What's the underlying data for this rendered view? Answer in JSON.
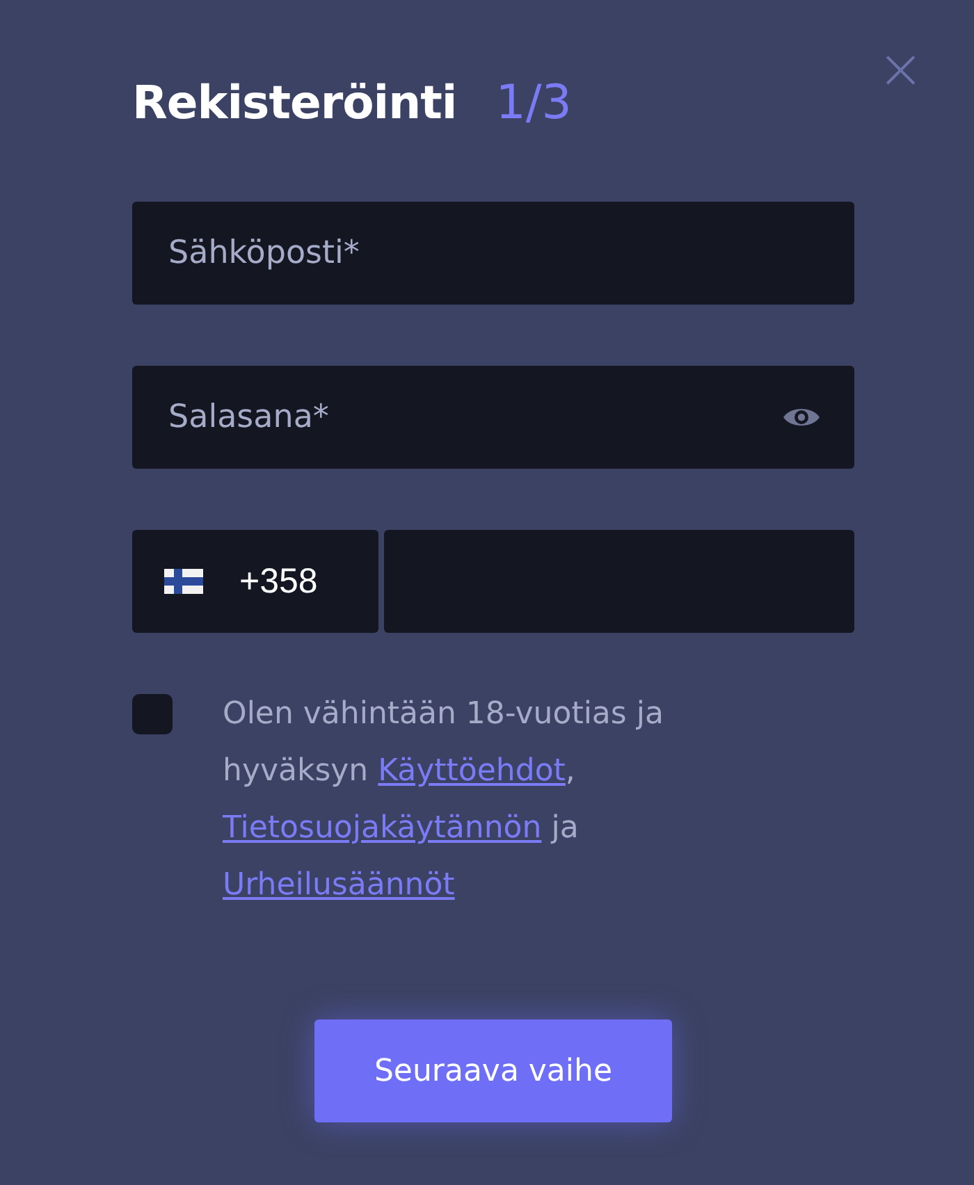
{
  "dialog": {
    "title": "Rekisteröinti",
    "step": "1/3",
    "close": "×"
  },
  "fields": [
    {
      "kind": "text",
      "placeholder": "Sähköposti*"
    },
    {
      "kind": "password",
      "placeholder": "Salasana*"
    }
  ],
  "phone": {
    "code": "+358"
  },
  "consent": {
    "checked": false,
    "parts": [
      {
        "kind": "text",
        "text": "Olen vähintään 18-vuotias ja hyväksyn "
      },
      {
        "kind": "link",
        "text": "Käyttöehdot"
      },
      {
        "kind": "text",
        "text": ", "
      },
      {
        "kind": "link",
        "text": "Tietosuojakäytännön"
      },
      {
        "kind": "text",
        "text": " ja "
      },
      {
        "kind": "link",
        "text": "Urheilusäännöt"
      }
    ]
  },
  "button": "Seuraava vaihe"
}
